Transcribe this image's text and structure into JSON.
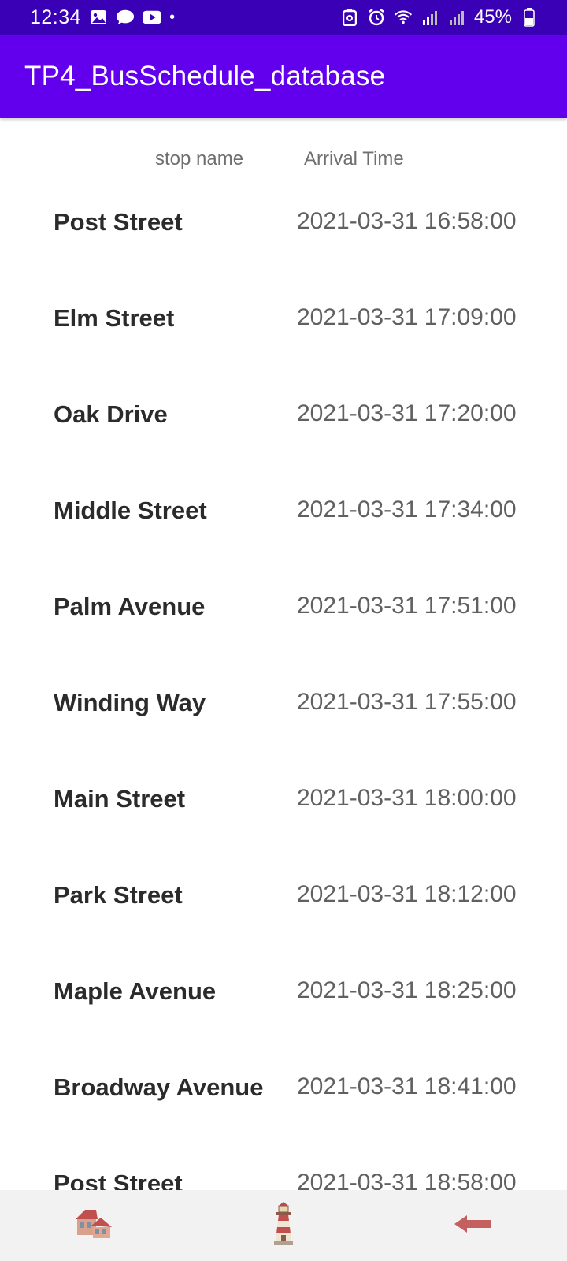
{
  "status_bar": {
    "time": "12:34",
    "dot": "•",
    "battery": "45%",
    "icons_left": [
      "gallery-icon",
      "chat-bubble-icon",
      "youtube-icon"
    ],
    "icons_right": [
      "nfc-icon",
      "alarm-icon",
      "wifi-icon",
      "signal-icon",
      "signal-icon",
      "battery-icon"
    ]
  },
  "app_bar": {
    "title": "TP4_BusSchedule_database",
    "color": "#6200ee"
  },
  "columns": {
    "stop": "stop name",
    "time": "Arrival Time"
  },
  "rows": [
    {
      "stop": "Post Street",
      "time": "2021-03-31 16:58:00"
    },
    {
      "stop": "Elm Street",
      "time": "2021-03-31 17:09:00"
    },
    {
      "stop": "Oak Drive",
      "time": "2021-03-31 17:20:00"
    },
    {
      "stop": "Middle Street",
      "time": "2021-03-31 17:34:00"
    },
    {
      "stop": "Palm Avenue",
      "time": "2021-03-31 17:51:00"
    },
    {
      "stop": "Winding Way",
      "time": "2021-03-31 17:55:00"
    },
    {
      "stop": "Main Street",
      "time": "2021-03-31 18:00:00"
    },
    {
      "stop": "Park Street",
      "time": "2021-03-31 18:12:00"
    },
    {
      "stop": "Maple Avenue",
      "time": "2021-03-31 18:25:00"
    },
    {
      "stop": "Broadway Avenue",
      "time": "2021-03-31 18:41:00"
    },
    {
      "stop": "Post Street",
      "time": "2021-03-31 18:58:00"
    }
  ],
  "bottom_nav": {
    "items": [
      "houses-icon",
      "lighthouse-icon",
      "back-arrow-icon"
    ]
  }
}
